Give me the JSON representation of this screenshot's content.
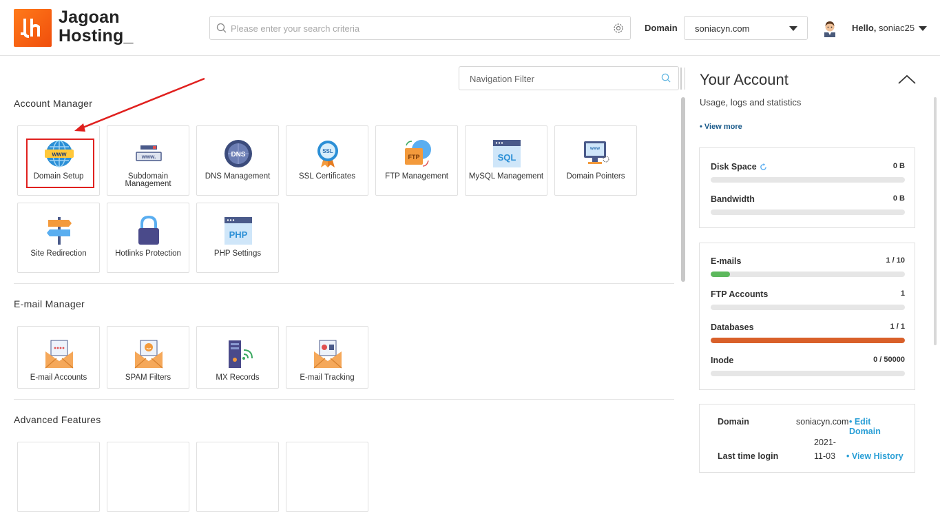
{
  "brand": {
    "line1": "Jagoan",
    "line2": "Hosting_",
    "logo_color": "#f4600f"
  },
  "search": {
    "placeholder": "Please enter your search criteria"
  },
  "domain": {
    "label": "Domain",
    "selected": "soniacyn.com"
  },
  "user": {
    "greeting": "Hello,",
    "name": "soniac25"
  },
  "nav_filter": {
    "placeholder": "Navigation Filter"
  },
  "sections": [
    {
      "title": "Account Manager",
      "tiles": [
        {
          "label": "Domain Setup",
          "icon": "globe-www-icon"
        },
        {
          "label": "Subdomain Management",
          "icon": "subdomain-icon"
        },
        {
          "label": "DNS Management",
          "icon": "dns-icon"
        },
        {
          "label": "SSL Certificates",
          "icon": "ssl-badge-icon"
        },
        {
          "label": "FTP Management",
          "icon": "ftp-folder-icon"
        },
        {
          "label": "MySQL Management",
          "icon": "mysql-icon"
        },
        {
          "label": "Domain Pointers",
          "icon": "domain-pointer-icon"
        },
        {
          "label": "Site Redirection",
          "icon": "signpost-icon"
        },
        {
          "label": "Hotlinks Protection",
          "icon": "padlock-icon"
        },
        {
          "label": "PHP Settings",
          "icon": "php-icon"
        }
      ]
    },
    {
      "title": "E-mail Manager",
      "tiles": [
        {
          "label": "E-mail Accounts",
          "icon": "email-accounts-icon"
        },
        {
          "label": "SPAM Filters",
          "icon": "spam-filter-icon"
        },
        {
          "label": "MX Records",
          "icon": "mx-records-icon"
        },
        {
          "label": "E-mail Tracking",
          "icon": "email-tracking-icon"
        }
      ]
    },
    {
      "title": "Advanced Features",
      "tiles": []
    }
  ],
  "account": {
    "title": "Your Account",
    "subtitle": "Usage, logs and statistics",
    "view_more": "• View more",
    "usage": [
      {
        "name": "Disk Space",
        "value": "0 B",
        "fraction": 0
      },
      {
        "name": "Bandwidth",
        "value": "0 B",
        "fraction": 0
      }
    ],
    "limits": [
      {
        "name": "E-mails",
        "value": "1 / 10",
        "fraction": 0.1,
        "color": "#5cb85c"
      },
      {
        "name": "FTP Accounts",
        "value": "1",
        "fraction": 0,
        "color": "#5cb85c"
      },
      {
        "name": "Databases",
        "value": "1 / 1",
        "fraction": 1,
        "color": "#d9602a"
      },
      {
        "name": "Inode",
        "value": "0 / 50000",
        "fraction": 0,
        "color": "#5cb85c"
      }
    ],
    "info": {
      "domain_key": "Domain",
      "domain_val": "soniacyn.com",
      "edit_domain": "• Edit Domain",
      "last_login_key": "Last time login",
      "last_login_val_1": "2021-",
      "last_login_val_2": "11-03",
      "view_history": "• View History"
    }
  }
}
